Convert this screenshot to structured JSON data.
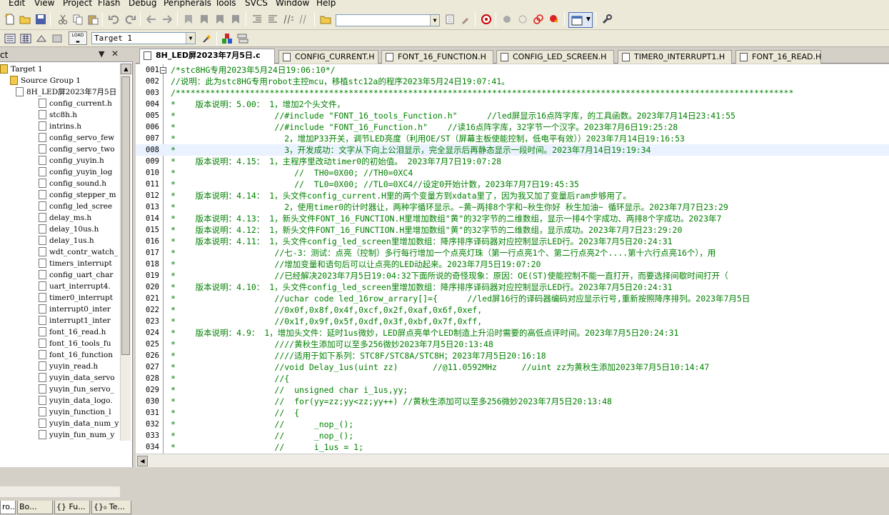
{
  "menu": [
    "Edit",
    "View",
    "Project",
    "Flash",
    "Debug",
    "Peripherals",
    "Tools",
    "SVCS",
    "Window",
    "Help"
  ],
  "toolbar": {
    "target_select": "Target 1",
    "load_label": "LOAD"
  },
  "project_panel": {
    "title": "ct",
    "pin_icon": "▼",
    "close_icon": "✕",
    "tree": [
      {
        "label": "Target 1",
        "level": 0
      },
      {
        "label": "Source Group 1",
        "level": 1
      },
      {
        "label": "8H_LED屏2023年7月5日",
        "level": 2
      },
      {
        "label": "config_current.h",
        "level": 3
      },
      {
        "label": "stc8h.h",
        "level": 3
      },
      {
        "label": "intrins.h",
        "level": 3
      },
      {
        "label": "config_servo_few",
        "level": 3
      },
      {
        "label": "config_servo_two",
        "level": 3
      },
      {
        "label": "config_yuyin.h",
        "level": 3
      },
      {
        "label": "config_yuyin_log",
        "level": 3
      },
      {
        "label": "config_sound.h",
        "level": 3
      },
      {
        "label": "config_stepper_m",
        "level": 3
      },
      {
        "label": "config_led_scree",
        "level": 3
      },
      {
        "label": "delay_ms.h",
        "level": 3
      },
      {
        "label": "delay_10us.h",
        "level": 3
      },
      {
        "label": "delay_1us.h",
        "level": 3
      },
      {
        "label": "wdt_contr_watch_",
        "level": 3
      },
      {
        "label": "timers_interrupt",
        "level": 3
      },
      {
        "label": "config_uart_char",
        "level": 3
      },
      {
        "label": "uart_interrupt4.",
        "level": 3
      },
      {
        "label": "timer0_interrupt",
        "level": 3
      },
      {
        "label": "interrupt0_inter",
        "level": 3
      },
      {
        "label": "interrupt1_inter",
        "level": 3
      },
      {
        "label": "font_16_read.h",
        "level": 3
      },
      {
        "label": "font_16_tools_fu",
        "level": 3
      },
      {
        "label": "font_16_function",
        "level": 3
      },
      {
        "label": "yuyin_read.h",
        "level": 3
      },
      {
        "label": "yuyin_data_servo",
        "level": 3
      },
      {
        "label": "yuyin_fun_servo_",
        "level": 3
      },
      {
        "label": "yuyin_data_logo.",
        "level": 3
      },
      {
        "label": "yuyin_function_l",
        "level": 3
      },
      {
        "label": "yuyin_data_num_y",
        "level": 3
      },
      {
        "label": "yuyin_fun_num_y",
        "level": 3
      }
    ],
    "bottom_tabs": [
      "ro...",
      "Bo...",
      "{} Fu...",
      "{}₀ Te..."
    ]
  },
  "editor_tabs": [
    {
      "label": "8H_LED屏2023年7月5日.c",
      "active": true
    },
    {
      "label": "CONFIG_CURRENT.H",
      "active": false
    },
    {
      "label": "FONT_16_FUNCTION.H",
      "active": false
    },
    {
      "label": "CONFIG_LED_SCREEN.H",
      "active": false
    },
    {
      "label": "TIMER0_INTERRUPT1.H",
      "active": false
    },
    {
      "label": "FONT_16_READ.H",
      "active": false
    }
  ],
  "code_lines": [
    {
      "n": "001",
      "t": "/*stc8HG专用2023年5月24日19:06:10*/"
    },
    {
      "n": "002",
      "t": "//说明：此为stc8HG专用robot主控mcu，移植stc12a的程序2023年5月24日19:07:41。"
    },
    {
      "n": "003",
      "t": "/*****************************************************************************************************************************"
    },
    {
      "n": "004",
      "t": "*    版本说明：5.00： 1，增加2个头文件，"
    },
    {
      "n": "005",
      "t": "*                    //#include \"FONT_16_tools_Function.h\"      //led屏显示16点阵字库，的工具函数。2023年7月14日23:41:55"
    },
    {
      "n": "006",
      "t": "*                    //#include \"FONT_16_Function.h\"    //读16点阵字库，32字节一个汉字。2023年7月6日19:25:28"
    },
    {
      "n": "007",
      "t": "*                      2，增加P33开关，调节LED亮度（利用OE/ST（屏幕主板使能控制，低电平有效））2023年7月14日19:16:53"
    },
    {
      "n": "008",
      "t": "*                      3，开发成功：文字从下向上公泪显示，完全显示后再静态显示一段时间。2023年7月14日19:19:34"
    },
    {
      "n": "009",
      "t": "*    版本说明：4.15： 1，主程序里改动timer0的初始值。 2023年7月7日19:07:28"
    },
    {
      "n": "010",
      "t": "*                        //  TH0=0X00; //TH0=0XC4"
    },
    {
      "n": "011",
      "t": "*                        //  TL0=0X00; //TL0=0XC4//设定0开始计数，2023年7月7日19:45:35"
    },
    {
      "n": "012",
      "t": "*    版本说明：4.14： 1，头文件config_current.H里的两个变量方到xdata里了，因为我又加了变量后ram步够用了。"
    },
    {
      "n": "013",
      "t": "*                      2，使用timer0的计时器让，两种字循环显示。~黄~两排8个字和~秋生你好 秋生加油~ 循环显示。2023年7月7日23:29"
    },
    {
      "n": "014",
      "t": "*    版本说明：4.13： 1，新头文件FONT_16_FUNCTION.H里增加数组\"黄\"的32字节的二维数组，显示一排4个字成功、两排8个字成功。2023年7"
    },
    {
      "n": "015",
      "t": "*    版本说明：4.12： 1，新头文件FONT_16_FUNCTION.H里增加数组\"黄\"的32字节的二维数组，显示成功。2023年7月7日23:29:20"
    },
    {
      "n": "016",
      "t": "*    版本说明：4.11： 1，头文件config_led_screen里增加数组：降序排序译码器对应控制显示LED行。2023年7月5日20:24:31"
    },
    {
      "n": "017",
      "t": "*                    //七-3：测试：点亮（控制）多行每行增加一个点亮灯珠（第一行点亮1个、第二行点亮2个....第十六行点亮16个），用"
    },
    {
      "n": "018",
      "t": "*                    //增加变量和语句后可以让点亮的LED动起来。2023年7月5日19:07:20"
    },
    {
      "n": "019",
      "t": "*                    //已经解决2023年7月5日19:04:32下面所说的奇怪现象：原因：OE(ST)使能控制不能一直打开，而要选择间歇时间打开（"
    },
    {
      "n": "020",
      "t": "*    版本说明：4.10： 1，头文件config_led_screen里增加数组：降序排序译码器对应控制显示LED行。2023年7月5日20:24:31"
    },
    {
      "n": "021",
      "t": "*                    //uchar code led_16row_arrary[]={      //led屏16行的译码器编码对应显示行号,重新按照降序排列。2023年7月5日"
    },
    {
      "n": "022",
      "t": "*                    //0x0f,0x8f,0x4f,0xcf,0x2f,0xaf,0x6f,0xef,"
    },
    {
      "n": "023",
      "t": "*                    //0x1f,0x9f,0x5f,0xdf,0x3f,0xbf,0x7f,0xff,"
    },
    {
      "n": "024",
      "t": "*    版本说明：4.9： 1，增加头文件：延时1us微妙，LED屏点亮单个LED制造上升沿时需要的高低点评时间。2023年7月5日20:24:31"
    },
    {
      "n": "025",
      "t": "*                    ////黄秋生添加可以至多256微妙2023年7月5日20:13:48"
    },
    {
      "n": "026",
      "t": "*                    ////适用于如下系列：STC8F/STC8A/STC8H；2023年7月5日20:16:18"
    },
    {
      "n": "027",
      "t": "*                    //void Delay_1us(uint zz)       //@11.0592MHz     //uint zz为黄秋生添加2023年7月5日10:14:47"
    },
    {
      "n": "028",
      "t": "*                    //{"
    },
    {
      "n": "029",
      "t": "*                    //  unsigned char i_1us,yy;"
    },
    {
      "n": "030",
      "t": "*                    //  for(yy=zz;yy<zz;yy++) //黄秋生添加可以至多256微妙2023年7月5日20:13:48"
    },
    {
      "n": "031",
      "t": "*                    //  {"
    },
    {
      "n": "032",
      "t": "*                    //      _nop_();"
    },
    {
      "n": "033",
      "t": "*                    //      _nop_();"
    },
    {
      "n": "034",
      "t": "*                    //      i_1us = 1;"
    }
  ]
}
